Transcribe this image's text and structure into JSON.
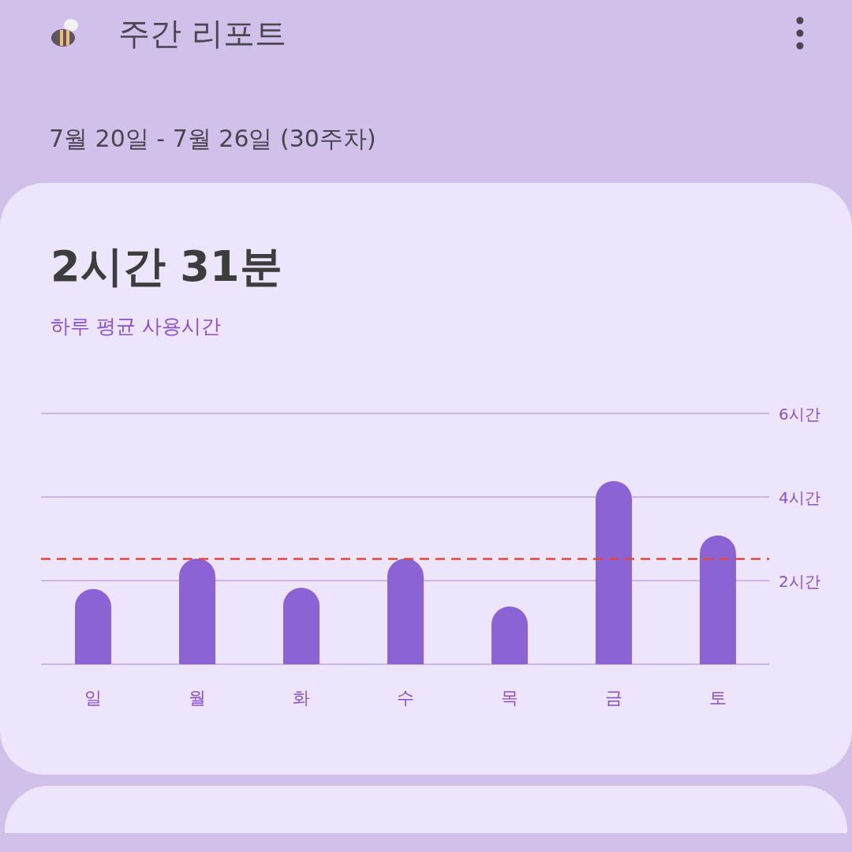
{
  "header": {
    "title": "주간 리포트",
    "date_range": "7월 20일 - 7월 26일 (30주차)"
  },
  "summary": {
    "total": "2시간 31분",
    "caption": "하루 평균 사용시간",
    "chart_data": {
      "type": "bar",
      "categories": [
        "일",
        "월",
        "화",
        "수",
        "목",
        "금",
        "토"
      ],
      "values": [
        1.8,
        2.53,
        1.83,
        2.53,
        1.38,
        4.38,
        3.08
      ],
      "ylim": [
        0,
        6
      ],
      "yticks": [
        {
          "value": 2,
          "label": "2시간"
        },
        {
          "value": 4,
          "label": "4시간"
        },
        {
          "value": 6,
          "label": "6시간"
        }
      ],
      "color": "#8b63d4",
      "ref_lines": [
        {
          "axis": "y",
          "value": 2.52,
          "color": "#e0483c"
        }
      ]
    }
  }
}
